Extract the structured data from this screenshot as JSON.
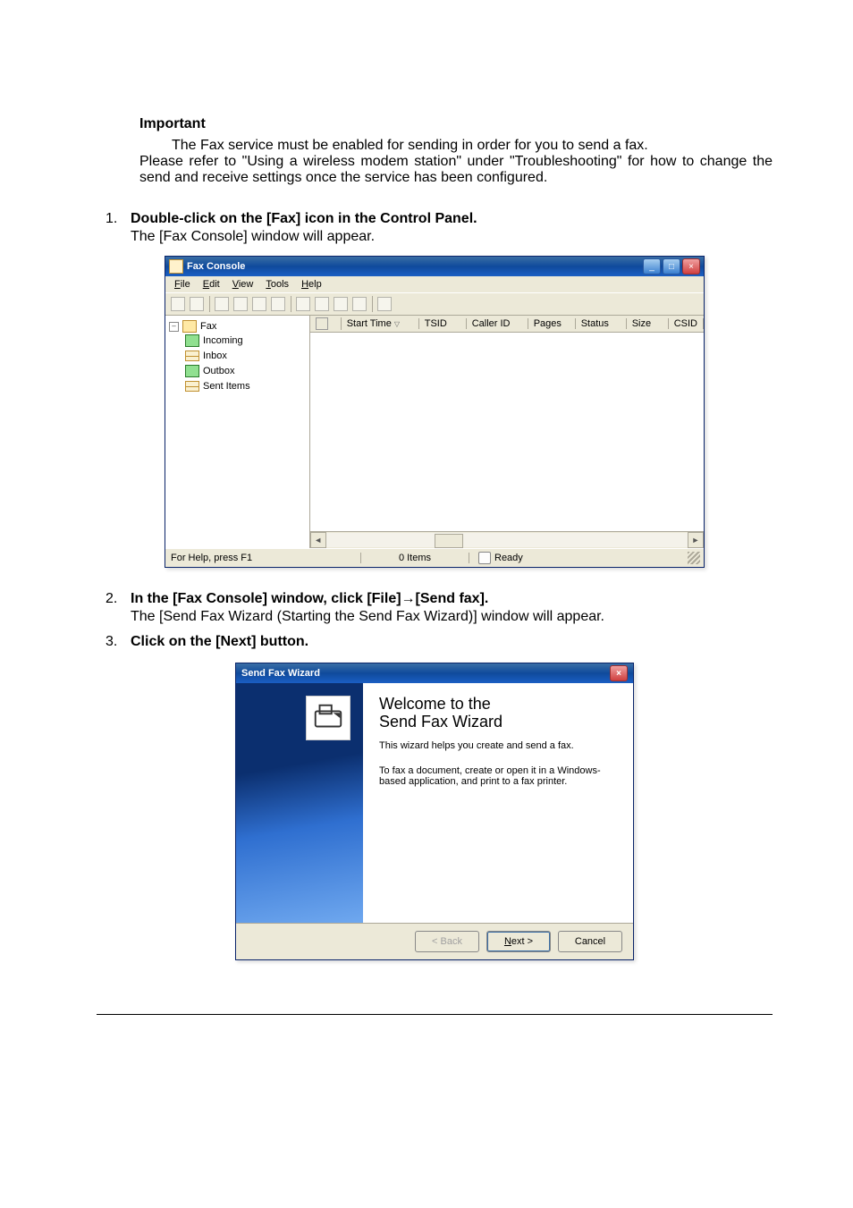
{
  "important": {
    "heading": "Important",
    "line1": "The Fax service must be enabled for sending in order for you to send a fax.",
    "line2": "Please refer to \"Using a wireless modem station\" under \"Troubleshooting\" for how to change the send and receive settings once the service has been configured."
  },
  "steps": {
    "s1": {
      "num": "1.",
      "title": "Double-click on the [Fax] icon in the Control Panel.",
      "desc": "The [Fax Console] window will appear."
    },
    "s2": {
      "num": "2.",
      "title": "In the [Fax Console] window, click [File]→[Send fax].",
      "desc": "The [Send Fax Wizard (Starting the Send Fax Wizard)] window will appear."
    },
    "s3": {
      "num": "3.",
      "title": "Click on the [Next] button."
    }
  },
  "fax_console": {
    "title": "Fax Console",
    "menus": {
      "file": "File",
      "edit": "Edit",
      "view": "View",
      "tools": "Tools",
      "help": "Help"
    },
    "tree": {
      "root": "Fax",
      "incoming": "Incoming",
      "inbox": "Inbox",
      "outbox": "Outbox",
      "sent": "Sent Items"
    },
    "columns": {
      "icon": "",
      "start_time": "Start Time",
      "tsid": "TSID",
      "caller_id": "Caller ID",
      "pages": "Pages",
      "status": "Status",
      "size": "Size",
      "csid": "CSID"
    },
    "status": {
      "help": "For Help, press F1",
      "items": "0 Items",
      "ready": "Ready"
    },
    "win_buttons": {
      "min": "_",
      "max": "□",
      "close": "×"
    },
    "scroll": {
      "left": "◄",
      "right": "►"
    },
    "expander": "–"
  },
  "wizard": {
    "title": "Send Fax Wizard",
    "close": "×",
    "heading_l1": "Welcome to the",
    "heading_l2": "Send Fax Wizard",
    "p1": "This wizard helps you create and send a fax.",
    "p2": "To fax a document, create or open it in a Windows-based application, and print to a fax printer.",
    "buttons": {
      "back": "< Back",
      "next": "Next >",
      "cancel": "Cancel"
    }
  }
}
